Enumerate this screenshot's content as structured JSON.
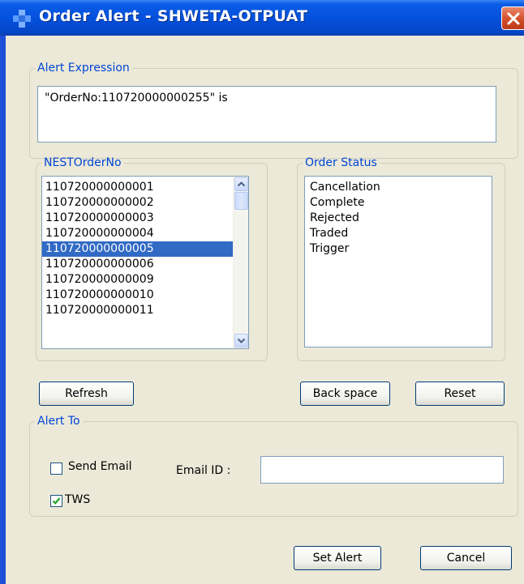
{
  "window": {
    "title": "Order Alert - SHWETA-OTPUAT"
  },
  "alert_expression": {
    "legend": "Alert Expression",
    "value": "\"OrderNo:110720000000255\" is"
  },
  "nest_order_no": {
    "legend": "NESTOrderNo",
    "items": [
      "110720000000001",
      "110720000000002",
      "110720000000003",
      "110720000000004",
      "110720000000005",
      "110720000000006",
      "110720000000009",
      "110720000000010",
      "110720000000011"
    ],
    "selected": "110720000000005"
  },
  "order_status": {
    "legend": "Order Status",
    "items": [
      "Cancellation",
      "Complete",
      "Rejected",
      "Traded",
      "Trigger"
    ]
  },
  "buttons": {
    "refresh": "Refresh",
    "back_space": "Back space",
    "reset": "Reset",
    "set_alert": "Set Alert",
    "cancel": "Cancel"
  },
  "alert_to": {
    "legend": "Alert To",
    "send_email_label": "Send Email",
    "send_email_checked": false,
    "email_id_label": "Email ID :",
    "email_id_value": "",
    "tws_label": "TWS",
    "tws_checked": true
  },
  "colors": {
    "titlebar": "#0451dd",
    "legend_text": "#0046d5",
    "selection": "#316ac5",
    "dialog_bg": "#ece9d8",
    "close_button": "#d04b27"
  }
}
